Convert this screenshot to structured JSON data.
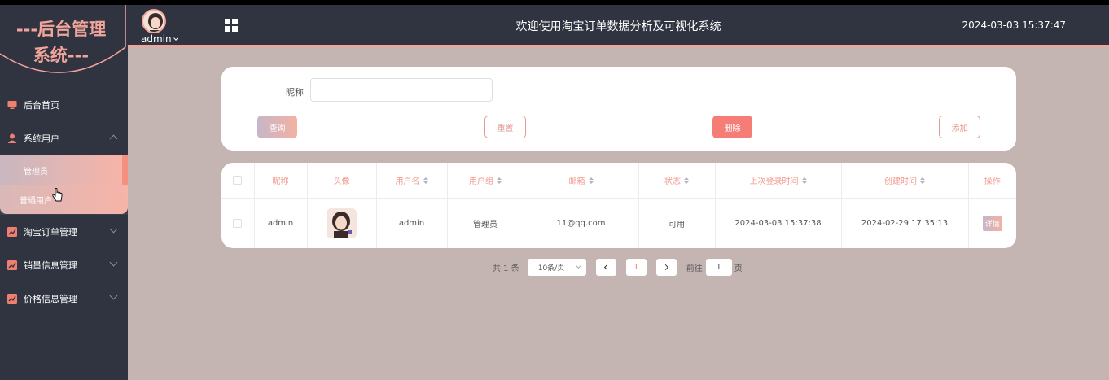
{
  "sidebar": {
    "logo_line1": "---后台管理",
    "logo_line2": "系统---",
    "items": [
      {
        "label": "后台首页"
      },
      {
        "label": "系统用户"
      },
      {
        "label": "淘宝订单管理"
      },
      {
        "label": "销量信息管理"
      },
      {
        "label": "价格信息管理"
      }
    ],
    "sub_items": [
      {
        "label": "管理员"
      },
      {
        "label": "普通用户"
      }
    ]
  },
  "header": {
    "username": "admin",
    "title": "欢迎使用淘宝订单数据分析及可视化系统",
    "datetime": "2024-03-03 15:37:47"
  },
  "search": {
    "label": "昵称",
    "value": "",
    "placeholder": "",
    "query_label": "查询",
    "reset_label": "重置",
    "delete_label": "删除",
    "add_label": "添加"
  },
  "table": {
    "columns": [
      "昵称",
      "头像",
      "用户名",
      "用户组",
      "邮箱",
      "状态",
      "上次登录时间",
      "创建时间",
      "操作"
    ],
    "rows": [
      {
        "nickname": "admin",
        "username": "admin",
        "group": "管理员",
        "email": "11@qq.com",
        "status": "可用",
        "last_login": "2024-03-03 15:37:38",
        "created": "2024-02-29 17:35:13",
        "action": "详情"
      }
    ]
  },
  "pagination": {
    "total": "共 1 条",
    "page_size": "10条/页",
    "current": "1",
    "goto_prefix": "前往",
    "goto_value": "1",
    "goto_suffix": "页"
  },
  "colors": {
    "accent": "#f4a39a",
    "sidebar_bg": "#2f3440",
    "content_bg": "#c4b5b3",
    "danger": "#f67d75"
  }
}
